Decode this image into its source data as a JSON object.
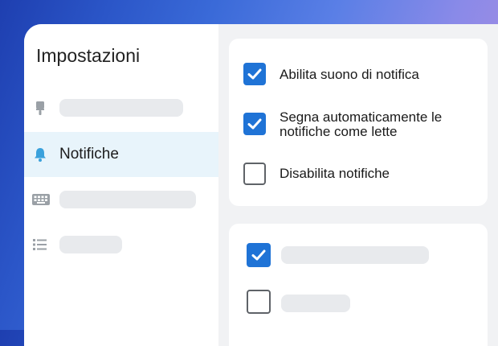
{
  "sidebar": {
    "title": "Impostazioni",
    "items": [
      {
        "icon": "brush-icon",
        "label": ""
      },
      {
        "icon": "bell-icon",
        "label": "Notifiche",
        "active": true
      },
      {
        "icon": "keyboard-icon",
        "label": ""
      },
      {
        "icon": "list-icon",
        "label": ""
      }
    ]
  },
  "notifications_panel": {
    "options": [
      {
        "label": "Abilita suono di notifica",
        "checked": true
      },
      {
        "label_line1": "Segna automaticamente le",
        "label_line2": "notifiche come lette",
        "checked": true
      },
      {
        "label": "Disabilita notifiche",
        "checked": false
      }
    ]
  },
  "second_panel": {
    "options": [
      {
        "checked": true
      },
      {
        "checked": false
      }
    ]
  },
  "colors": {
    "accent": "#1f73d6",
    "active_nav_bg": "#e8f4fb",
    "icon_color": "#9aa0a6",
    "bell_color": "#3aa1dc",
    "skeleton": "#e8eaed"
  }
}
